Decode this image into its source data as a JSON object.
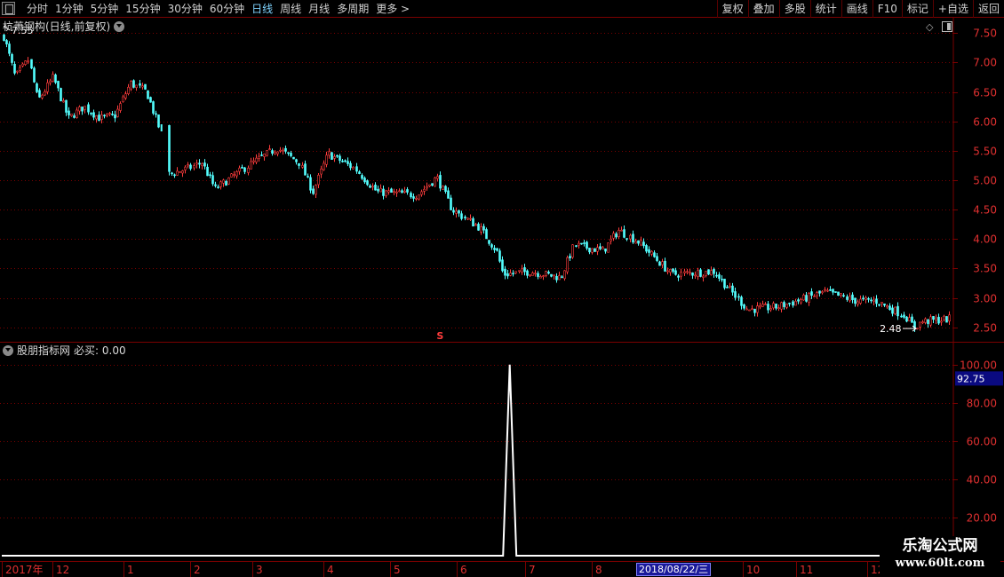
{
  "toolbar": {
    "periods": [
      "分时",
      "1分钟",
      "5分钟",
      "15分钟",
      "30分钟",
      "60分钟",
      "日线",
      "周线",
      "月线",
      "多周期",
      "更多 >"
    ],
    "active_period": "日线",
    "tools": [
      "复权",
      "叠加",
      "多股",
      "统计",
      "画线",
      "F10",
      "标记",
      "+自选",
      "返回"
    ]
  },
  "price_pane": {
    "title": "杭萧钢构(日线,前复权)",
    "high_label": "7.55",
    "low_label": "2.48",
    "marker": "S",
    "y_ticks": [
      "7.50",
      "7.00",
      "6.50",
      "6.00",
      "5.50",
      "5.00",
      "4.50",
      "4.00",
      "3.50",
      "3.00",
      "2.50"
    ]
  },
  "indicator_pane": {
    "title": "股朋指标网",
    "value_text": "必买: 0.00",
    "current_value": "92.75",
    "y_ticks": [
      "100.00",
      "80.00",
      "60.00",
      "40.00",
      "20.00"
    ]
  },
  "time_axis": {
    "months": [
      "2017年",
      "12",
      "1",
      "2",
      "3",
      "4",
      "5",
      "6",
      "7",
      "8",
      "9",
      "10",
      "11",
      "12"
    ],
    "crosshair_date": "2018/08/22/三"
  },
  "watermark": {
    "title": "乐淘公式网",
    "url": "www.60lt.com"
  },
  "colors": {
    "up": "#ff3c3c",
    "down": "#54ffff",
    "grid": "#7a0000",
    "axis_text": "#e03030",
    "indicator_line": "#ffffff"
  },
  "chart_data": [
    {
      "type": "candlestick",
      "title": "杭萧钢构(日线,前复权)",
      "ylim": [
        2.3,
        7.7
      ],
      "y_ticks": [
        7.5,
        7.0,
        6.5,
        6.0,
        5.5,
        5.0,
        4.5,
        4.0,
        3.5,
        3.0,
        2.5
      ],
      "grid": true,
      "close_path": [
        [
          "2017-11-08",
          7.55
        ],
        [
          "2017-11-14",
          6.75
        ],
        [
          "2017-11-20",
          7.05
        ],
        [
          "2017-11-24",
          6.35
        ],
        [
          "2017-12-01",
          6.75
        ],
        [
          "2017-12-08",
          6.05
        ],
        [
          "2017-12-15",
          6.25
        ],
        [
          "2017-12-22",
          6.05
        ],
        [
          "2017-12-29",
          6.1
        ],
        [
          "2018-01-05",
          6.65
        ],
        [
          "2018-01-12",
          6.5
        ],
        [
          "2018-01-19",
          5.75
        ],
        [
          "2018-01-22",
          5.1
        ],
        [
          "2018-01-31",
          5.2
        ],
        [
          "2018-02-06",
          5.3
        ],
        [
          "2018-02-12",
          4.85
        ],
        [
          "2018-03-01",
          5.3
        ],
        [
          "2018-03-12",
          5.55
        ],
        [
          "2018-03-22",
          5.3
        ],
        [
          "2018-03-28",
          4.8
        ],
        [
          "2018-04-04",
          5.45
        ],
        [
          "2018-04-16",
          5.2
        ],
        [
          "2018-04-26",
          4.8
        ],
        [
          "2018-05-14",
          4.75
        ],
        [
          "2018-05-23",
          5.05
        ],
        [
          "2018-05-30",
          4.5
        ],
        [
          "2018-06-11",
          4.2
        ],
        [
          "2018-06-19",
          3.8
        ],
        [
          "2018-06-22",
          3.4
        ],
        [
          "2018-07-04",
          3.45
        ],
        [
          "2018-07-18",
          3.35
        ],
        [
          "2018-07-24",
          3.9
        ],
        [
          "2018-08-06",
          3.8
        ],
        [
          "2018-08-13",
          4.15
        ],
        [
          "2018-08-22",
          3.95
        ],
        [
          "2018-09-06",
          3.4
        ],
        [
          "2018-09-25",
          3.45
        ],
        [
          "2018-10-10",
          2.8
        ],
        [
          "2018-10-24",
          2.85
        ],
        [
          "2018-11-14",
          3.1
        ],
        [
          "2018-11-28",
          2.95
        ],
        [
          "2018-12-07",
          2.95
        ],
        [
          "2018-12-20",
          2.7
        ],
        [
          "2018-12-24",
          2.5
        ],
        [
          "2018-12-28",
          2.6
        ],
        [
          "2019-01-11",
          2.65
        ]
      ],
      "annotations": [
        {
          "label": "7.55",
          "type": "high"
        },
        {
          "label": "2.48",
          "type": "low"
        }
      ]
    },
    {
      "type": "line",
      "title": "股朋指标网",
      "series": [
        {
          "name": "必买",
          "points": [
            [
              "2017-11-08",
              0
            ],
            [
              "2018-06-22",
              0
            ],
            [
              "2018-06-25",
              100
            ],
            [
              "2018-06-28",
              0
            ],
            [
              "2019-01-11",
              0
            ]
          ]
        }
      ],
      "ylim": [
        0,
        105
      ],
      "y_ticks": [
        100,
        80,
        60,
        40,
        20
      ],
      "current_value": 92.75,
      "grid": true
    }
  ]
}
